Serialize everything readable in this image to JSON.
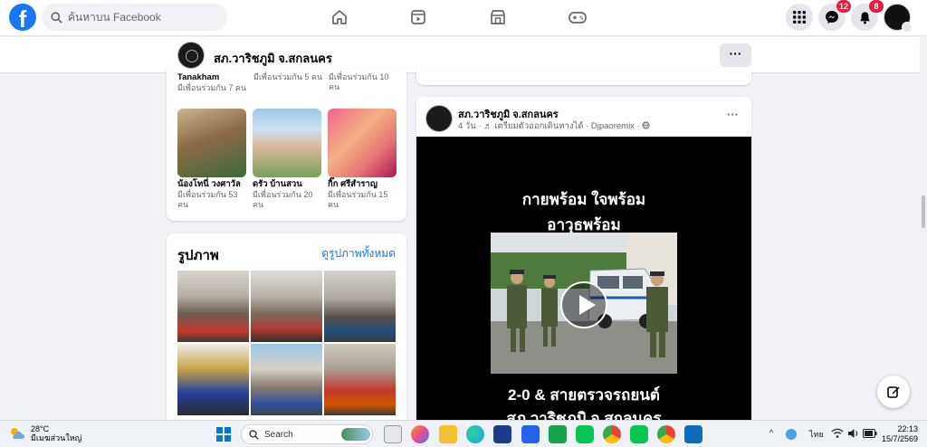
{
  "header": {
    "logo_letter": "f",
    "search_placeholder": "ค้นหาบน Facebook",
    "notifications": {
      "messenger_count": "12",
      "bell_count": "8"
    }
  },
  "page_bar": {
    "name": "สภ.วาริชภูมิ จ.สกลนคร",
    "more_label": "···"
  },
  "friends": [
    {
      "name": "น้องโทนี่ วงศาวัล",
      "mutual": "มีเพื่อนร่วมกัน 53 คน"
    },
    {
      "name": "ดรัว บ้านสวน",
      "mutual": "มีเพื่อนร่วมกัน 20 คน"
    },
    {
      "name": "กิ๊ก ศรีสำราญ",
      "mutual": "มีเพื่อนร่วมกัน 15 คน"
    }
  ],
  "friends_top_row": {
    "name_first": "Tanakham",
    "mutual_first": "มีเพื่อนร่วมกัน 7 คน",
    "mutual_second": "มีเพื่อนร่วมกัน 5 คน",
    "mutual_third": "มีเพื่อนร่วมกัน 10 คน"
  },
  "photos": {
    "title": "รูปภาพ",
    "see_all": "ดูรูปภาพทั้งหมด"
  },
  "post": {
    "author": "สภ.วาริชภูมิ จ.สกลนคร",
    "meta": "4 วัน · ♬ เตรียมตัวออกเดินทางได้ · Djpaoremix · ",
    "dots": "···",
    "video_line1": "กายพร้อม ใจพร้อม",
    "video_line2": "อาวุธพร้อม",
    "video_line3": "2-0 & สายตรวจรถยนต์",
    "video_line4": "สภ.วาริชภูมิ จ.สกลนคร"
  },
  "taskbar": {
    "temperature": "28°C",
    "weather_desc": "มีเมฆส่วนใหญ่",
    "search_label": "Search",
    "language": "ไทย",
    "time": "22:13",
    "date": "15/7/2569"
  },
  "colors": {
    "facebook_blue": "#1877f2",
    "badge_red": "#e41e3f",
    "background": "#f0f2f5"
  }
}
